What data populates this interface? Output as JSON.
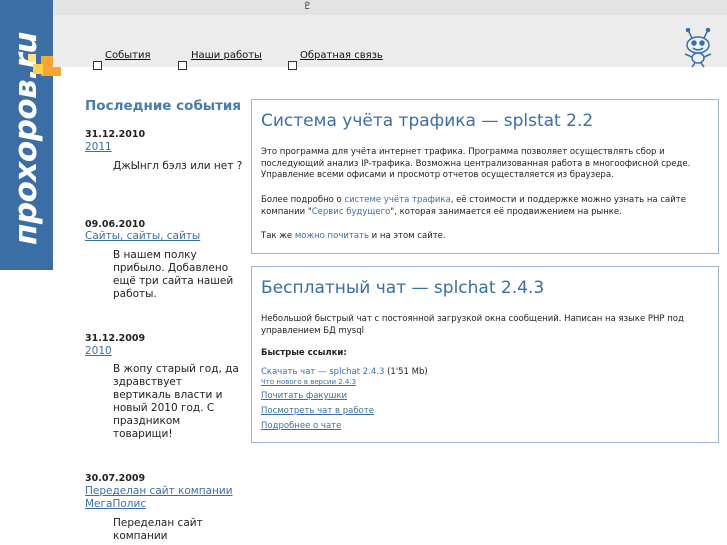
{
  "logo": {
    "main": "прохоров",
    "suffix": ".ru"
  },
  "nav": {
    "items": [
      "События",
      "Наши работы",
      "Обратная связь"
    ]
  },
  "sidebar": {
    "heading": "Последние события",
    "events": [
      {
        "date": "31.12.2010",
        "title": "2011",
        "text": "ДжЫнгл бэлз или нет ?"
      },
      {
        "date": "09.06.2010",
        "title": "Сайты, сайты, сайты",
        "text": "В нашем полку прибыло. Добавлено ещё три сайта нашей работы."
      },
      {
        "date": "31.12.2009",
        "title": "2010",
        "text": "В жопу старый год, да здравствует вертикаль власти и новый 2010 год. С праздником товарищи!"
      },
      {
        "date": "30.07.2009",
        "title": "Переделан сайт компании МегаПолис",
        "text": "Переделан сайт компании"
      }
    ]
  },
  "splstat": {
    "title": "Система учёта трафика — splstat 2.2",
    "p1": "Это программа для учёта интернет трафика. Программа позволяет осуществлять сбор и последующий анализ IP-трафика. Возможна централизованная работа в многоофисной среде. Управление всеми офисами и просмотр отчетов осуществляется из браузера.",
    "p2_a": "Более подробно о ",
    "p2_link1": "системе учёта трафика",
    "p2_b": ", её стоимости и поддержке можно узнать на сайте компании \"",
    "p2_link2": "Сервис будущего",
    "p2_c": "\", которая занимается её продвижением на рынке.",
    "p3_a": "Так же ",
    "p3_link": "можно почитать",
    "p3_b": " и на этом сайте."
  },
  "splchat": {
    "title": "Бесплатный чат — splchat 2.4.3",
    "p1": "Небольшой быстрый чат с постоянной загрузкой окна сообщений. Написан на языке PHP под управлением БД mysql",
    "quick_links_label": "Быстрые ссылки:",
    "download_link": "Скачать чат — splchat 2.4.3",
    "download_size": " (1'51 Mb)",
    "whats_new": "Что нового в версии 2.4.3",
    "links": [
      "Почитать факушки",
      "Посмотреть чат в работе",
      "Подробнее о чате"
    ]
  },
  "colors": {
    "brand_blue": "#3b6ea5",
    "accent_orange": "#f7a631",
    "border": "#9cb5cd"
  }
}
